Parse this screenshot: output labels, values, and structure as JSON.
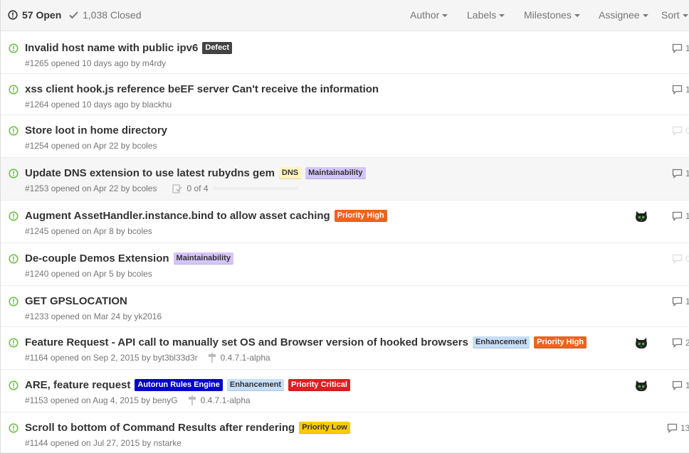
{
  "header": {
    "open_label": "57 Open",
    "closed_label": "1,038 Closed",
    "filters": [
      "Author",
      "Labels",
      "Milestones",
      "Assignee",
      "Sort"
    ]
  },
  "issues": [
    {
      "title": "Invalid host name with public ipv6",
      "meta": "#1265 opened 10 days ago by m4rdy",
      "comments": "1",
      "labels": [
        {
          "name": "Defect",
          "bg": "#444444",
          "fg": "#ffffff"
        }
      ]
    },
    {
      "title": "xss client hook.js reference beEF server Can't receive the information",
      "meta": "#1264 opened 10 days ago by blackhu",
      "comments": "1",
      "labels": []
    },
    {
      "title": "Store loot in home directory",
      "meta": "#1254 opened on Apr 22 by bcoles",
      "comments": "0",
      "labels": []
    },
    {
      "title": "Update DNS extension to use latest rubydns gem",
      "meta": "#1253 opened on Apr 22 by bcoles",
      "comments": "1",
      "tasks": "0 of 4",
      "labels": [
        {
          "name": "DNS",
          "bg": "#fef2c0",
          "fg": "#333333"
        },
        {
          "name": "Maintainability",
          "bg": "#d4c5f9",
          "fg": "#333333"
        }
      ]
    },
    {
      "title": "Augment AssetHandler.instance.bind to allow asset caching",
      "meta": "#1245 opened on Apr 8 by bcoles",
      "comments": "1",
      "assignee": true,
      "labels": [
        {
          "name": "Priority High",
          "bg": "#eb6420",
          "fg": "#ffffff"
        }
      ]
    },
    {
      "title": "De-couple Demos Extension",
      "meta": "#1240 opened on Apr 5 by bcoles",
      "comments": "0",
      "labels": [
        {
          "name": "Maintainability",
          "bg": "#d4c5f9",
          "fg": "#333333"
        }
      ]
    },
    {
      "title": "GET GPSLOCATION",
      "meta": "#1233 opened on Mar 24 by yk2016",
      "comments": "1",
      "labels": []
    },
    {
      "title": "Feature Request - API call to manually set OS and Browser version of hooked browsers",
      "meta": "#1164 opened on Sep 2, 2015 by byt3bl33d3r",
      "comments": "2",
      "milestone": "0.4.7.1-alpha",
      "assignee": true,
      "labels": [
        {
          "name": "Enhancement",
          "bg": "#c7def8",
          "fg": "#333333"
        },
        {
          "name": "Priority High",
          "bg": "#eb6420",
          "fg": "#ffffff"
        }
      ]
    },
    {
      "title": "ARE, feature request",
      "meta": "#1153 opened on Aug 4, 2015 by benyG",
      "comments": "1",
      "milestone": "0.4.7.1-alpha",
      "assignee": true,
      "labels": [
        {
          "name": "Autorun Rules Engine",
          "bg": "#0000cc",
          "fg": "#ffffff"
        },
        {
          "name": "Enhancement",
          "bg": "#c7def8",
          "fg": "#333333"
        },
        {
          "name": "Priority Critical",
          "bg": "#e11d21",
          "fg": "#ffffff"
        }
      ]
    },
    {
      "title": "Scroll to bottom of Command Results after rendering",
      "meta": "#1144 opened on Jul 27, 2015 by nstarke",
      "comments": "13",
      "labels": [
        {
          "name": "Priority Low",
          "bg": "#fbca04",
          "fg": "#333333"
        }
      ]
    }
  ]
}
